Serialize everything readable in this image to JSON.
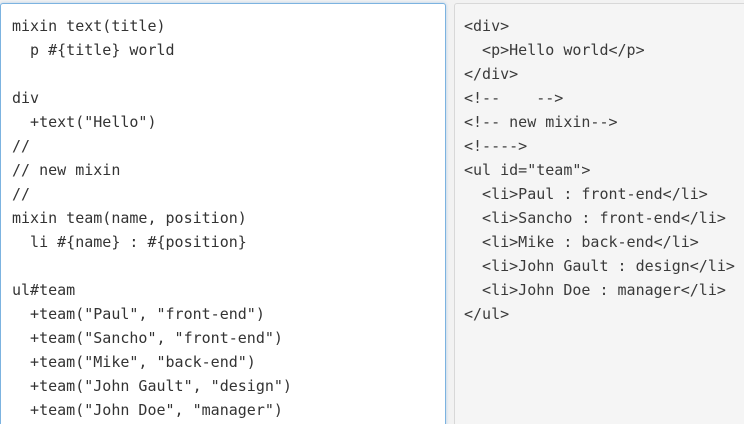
{
  "editor": {
    "lines": [
      "mixin text(title)",
      "  p #{title} world",
      "",
      "div",
      "  +text(\"Hello\")",
      "//",
      "// new mixin",
      "//",
      "mixin team(name, position)",
      "  li #{name} : #{position}",
      "",
      "ul#team",
      "  +team(\"Paul\", \"front-end\")",
      "  +team(\"Sancho\", \"front-end\")",
      "  +team(\"Mike\", \"back-end\")",
      "  +team(\"John Gault\", \"design\")",
      "  +team(\"John Doe\", \"manager\")"
    ]
  },
  "output": {
    "lines": [
      "<div>",
      "  <p>Hello world</p>",
      "</div>",
      "<!--    -->",
      "<!-- new mixin-->",
      "<!---->",
      "<ul id=\"team\">",
      "  <li>Paul : front-end</li>",
      "  <li>Sancho : front-end</li>",
      "  <li>Mike : back-end</li>",
      "  <li>John Gault : design</li>",
      "  <li>John Doe : manager</li>",
      "</ul>"
    ]
  }
}
